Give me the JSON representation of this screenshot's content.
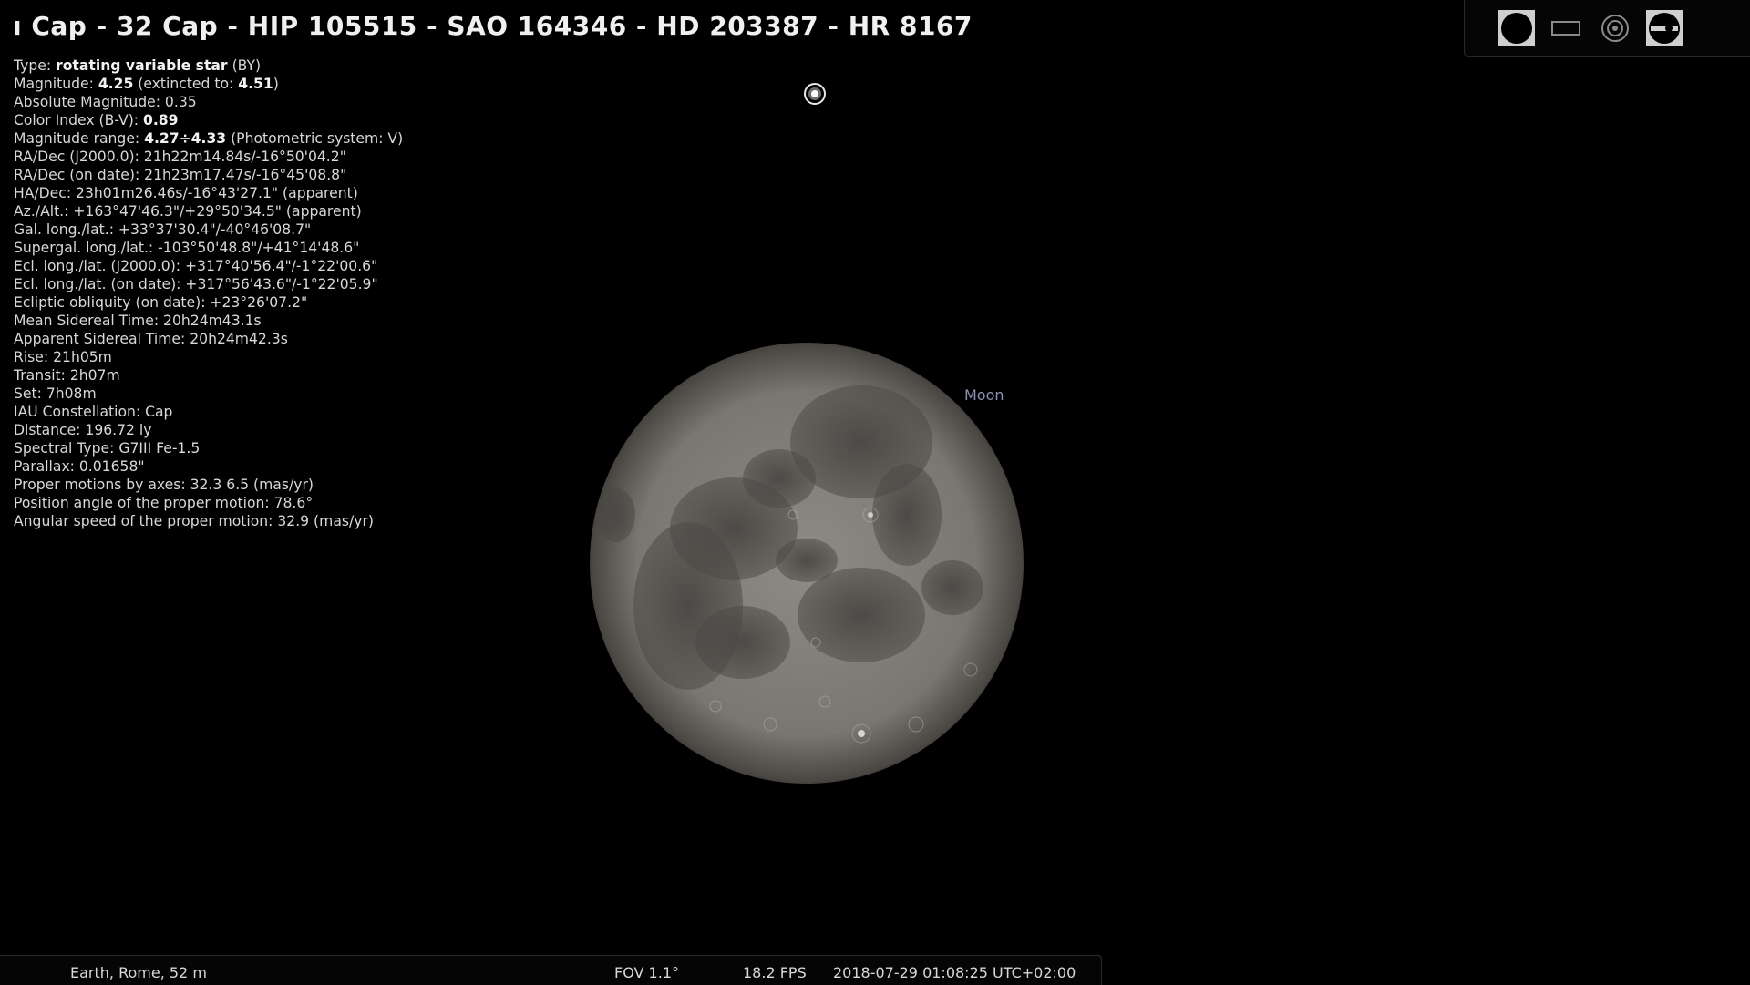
{
  "title": "ı Cap - 32 Cap - HIP 105515 - SAO 164346 - HD 203387 - HR 8167",
  "info": {
    "type_label": "Type: ",
    "type_value": "rotating variable star",
    "type_suffix": " (BY)",
    "mag_label": "Magnitude: ",
    "mag_value": "4.25",
    "mag_mid": " (extincted to: ",
    "mag_ext": "4.51",
    "mag_end": ")",
    "abs_mag": "Absolute Magnitude: 0.35",
    "ci_label": "Color Index (B-V): ",
    "ci_value": "0.89",
    "range_label": "Magnitude range: ",
    "range_value": "4.27÷4.33",
    "range_suffix": " (Photometric system: V)",
    "lines": [
      "RA/Dec (J2000.0): 21h22m14.84s/-16°50'04.2\"",
      "RA/Dec (on date): 21h23m17.47s/-16°45'08.8\"",
      "HA/Dec: 23h01m26.46s/-16°43'27.1\" (apparent)",
      "Az./Alt.: +163°47'46.3\"/+29°50'34.5\" (apparent)",
      "Gal. long./lat.: +33°37'30.4\"/-40°46'08.7\"",
      "Supergal. long./lat.: -103°50'48.8\"/+41°14'48.6\"",
      "Ecl. long./lat. (J2000.0): +317°40'56.4\"/-1°22'00.6\"",
      "Ecl. long./lat. (on date): +317°56'43.6\"/-1°22'05.9\"",
      "Ecliptic obliquity (on date): +23°26'07.2\"",
      "Mean Sidereal Time: 20h24m43.1s",
      "Apparent Sidereal Time: 20h24m42.3s",
      "Rise: 21h05m",
      "Transit: 2h07m",
      "Set: 7h08m",
      "IAU Constellation: Cap",
      "Distance: 196.72 ly",
      "Spectral Type: G7III Fe-1.5",
      "Parallax: 0.01658\"",
      "Proper motions by axes: 32.3 6.5 (mas/yr)",
      "Position angle of the proper motion: 78.6°",
      "Angular speed of the proper motion: 32.9 (mas/yr)"
    ]
  },
  "moon": {
    "label": "Moon"
  },
  "toolbar": {
    "icons": [
      "ground-icon",
      "atmosphere-frame-icon",
      "target-icon",
      "fov-toggle-icon"
    ]
  },
  "statusbar": {
    "location": "Earth, Rome, 52 m",
    "fov": "FOV 1.1°",
    "fps": "18.2 FPS",
    "datetime": "2018-07-29 01:08:25 UTC+02:00"
  },
  "colors": {
    "background": "#000000",
    "text": "#d8d8d8",
    "moon_label": "#8c92b6"
  }
}
